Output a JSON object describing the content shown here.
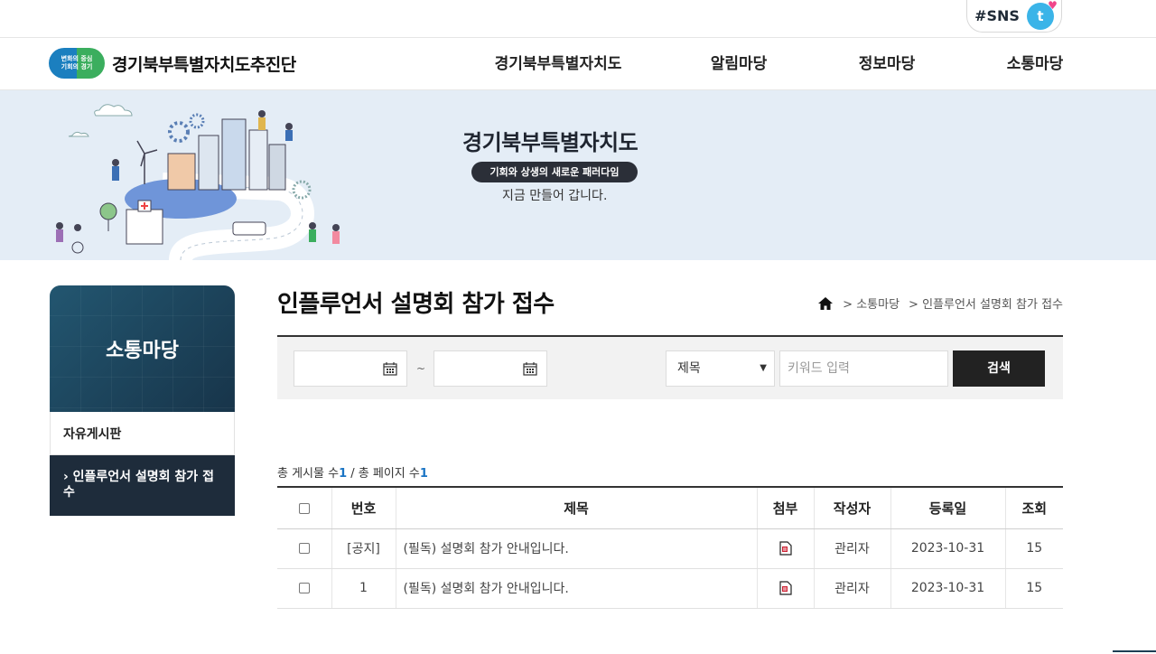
{
  "util": {
    "sns_label": "#SNS",
    "sns_icon": "sns-icon"
  },
  "header": {
    "logo_badge": "변화의 중심\n기회의 경기",
    "logo_text": "경기북부특별자치도추진단",
    "menu": [
      "경기북부특별자치도",
      "알림마당",
      "정보마당",
      "소통마당"
    ]
  },
  "banner": {
    "title": "경기북부특별자치도",
    "pill": "기회와 상생의 새로운 패러다임",
    "sub": "지금 만들어 갑니다."
  },
  "sidebar": {
    "title": "소통마당",
    "items": [
      {
        "label": "자유게시판"
      },
      {
        "label": "› 인플루언서 설명회 참가 접수"
      }
    ]
  },
  "content": {
    "page_title": "인플루언서 설명회 참가 접수",
    "breadcrumb": [
      "> 소통마당",
      "> 인플루언서 설명회 참가 접수"
    ],
    "search": {
      "tilde": "~",
      "select_value": "제목",
      "keyword_placeholder": "키워드 입력",
      "button": "검색"
    },
    "total": {
      "label_posts": "총 게시물 수",
      "posts": "1",
      "sep": " / 총 페이지 수",
      "pages": "1"
    },
    "table": {
      "headers": [
        "번호",
        "제목",
        "첨부",
        "작성자",
        "등록일",
        "조회"
      ],
      "rows": [
        {
          "no": "[공지]",
          "title": "(필독) 설명회 참가 안내입니다.",
          "author": "관리자",
          "date": "2023-10-31",
          "views": "15"
        },
        {
          "no": "1",
          "title": "(필독) 설명회 참가 안내입니다.",
          "author": "관리자",
          "date": "2023-10-31",
          "views": "15"
        }
      ]
    }
  }
}
